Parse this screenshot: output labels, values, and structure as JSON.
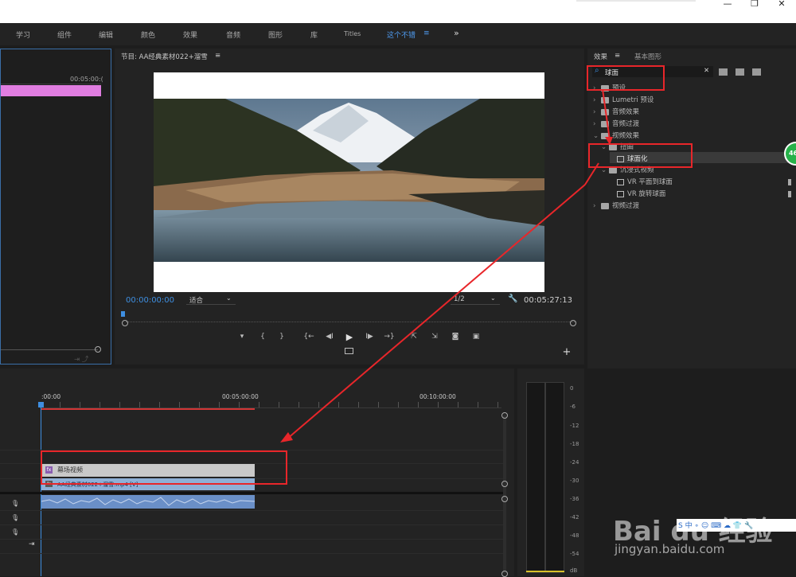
{
  "window": {
    "minimize_glyph": "—",
    "restore_glyph": "❐",
    "close_glyph": "✕"
  },
  "menu": {
    "items": [
      "学习",
      "组件",
      "编辑",
      "颜色",
      "效果",
      "音频",
      "图形",
      "库",
      "Titles",
      "这个不错"
    ],
    "active": "这个不错",
    "active_menu_glyph": "≡",
    "overflow_glyph": "»"
  },
  "source": {
    "timecode": "00:05:00:("
  },
  "program": {
    "title": "节目: AA经典素材022+溜雪",
    "menu_glyph": "≡",
    "timecode_current": "00:00:00:00",
    "fit_label": "适合",
    "resolution": "1/2",
    "timecode_total": "00:05:27:13",
    "transport": {
      "marker": "▾",
      "in_point": "{",
      "out_point": "}",
      "go_in": "{←",
      "step_back": "◀I",
      "play": "▶",
      "step_fwd": "I▶",
      "go_out": "→}",
      "lift": "⇱",
      "extract": "⇲",
      "camera": "◙",
      "compare": "▣",
      "add": "+"
    }
  },
  "effects": {
    "tab_effects": "效果",
    "tab_menu_glyph": "≡",
    "tab_basic_graphics": "基本图形",
    "search_value": "球面",
    "search_icon_glyph": "⌕",
    "clear_glyph": "✕",
    "tree": [
      {
        "label": "预设",
        "expanded": false
      },
      {
        "label": "Lumetri 预设",
        "expanded": false
      },
      {
        "label": "音频效果",
        "expanded": false
      },
      {
        "label": "音频过渡",
        "expanded": false
      },
      {
        "label": "视频效果",
        "expanded": true
      },
      {
        "label": "扭曲",
        "expanded": true
      },
      {
        "label": "球面化",
        "selected": true
      },
      {
        "label": "沉浸式视频",
        "expanded": true
      },
      {
        "label": "VR 平面到球面"
      },
      {
        "label": "VR 旋转球面"
      },
      {
        "label": "视频过渡",
        "expanded": false
      }
    ]
  },
  "timeline": {
    "ruler_labels": [
      ":00:00",
      "00:05:00:00",
      "00:10:00:00"
    ],
    "clip_fx_label": "幕场视频",
    "clip_video_label": "AA经典素材022+溜雪.mp4 [V]",
    "fx_badge": "fx",
    "mic_glyph": "🎙",
    "arrow_glyph": "⇥"
  },
  "audio_meter": {
    "scale": [
      "0",
      "-6",
      "-12",
      "-18",
      "-24",
      "-30",
      "-36",
      "-42",
      "-48",
      "-54",
      "dB"
    ]
  },
  "overlay": {
    "side_badge": "46",
    "watermark_brand": "Bai du 经验",
    "watermark_url": "jingyan.baidu.com",
    "ime_text": "S 中 ∘ ☺ ⌨ ☁ 👕 🔧"
  },
  "colors": {
    "accent_blue": "#3e8ee0",
    "clip_pink": "#e07de0",
    "clip_fx_gray": "#c9c9c9",
    "clip_video_blue": "#8fb0d6",
    "audio_wave": "#6a8fc7",
    "annotation_red": "#e8262a",
    "badge_green": "#27b24a"
  }
}
